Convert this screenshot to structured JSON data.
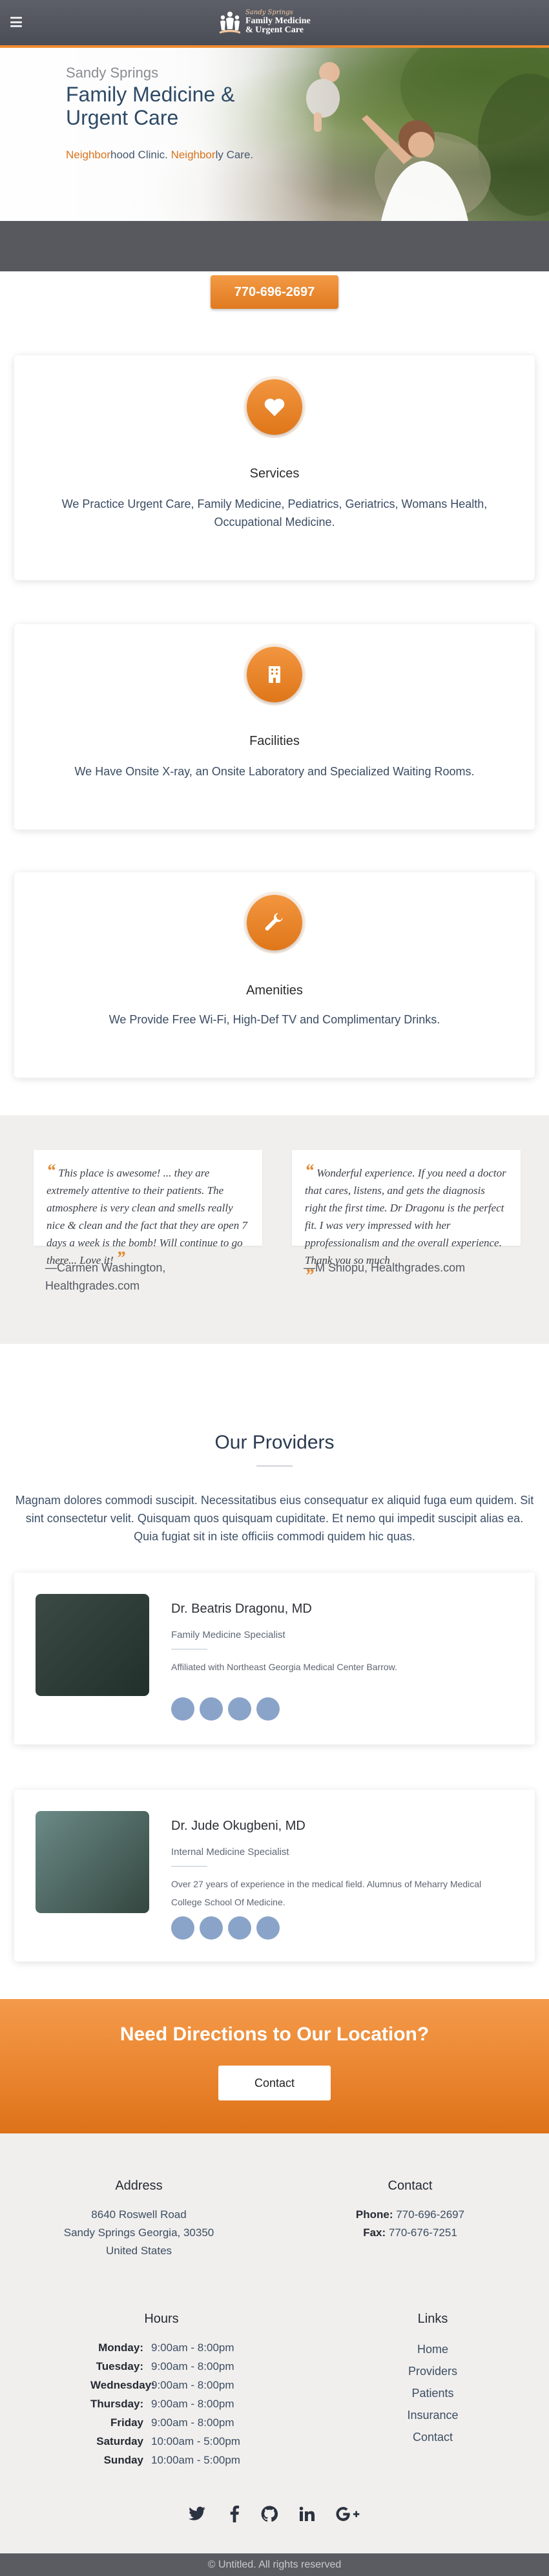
{
  "brand": {
    "logo_script": "Sandy Springs",
    "logo_line1": "Family Medicine",
    "logo_line2": "& Urgent Care"
  },
  "nav": {
    "menu_icon": "hamburger-menu-icon"
  },
  "hero": {
    "kicker": "Sandy Springs",
    "title": "Family Medicine & Urgent Care",
    "tag_accent_1": "Neighbor",
    "tag_plain_1": "hood Clinic. ",
    "tag_accent_2": "Neighbor",
    "tag_plain_2": "ly Care.",
    "phone": "770-696-2697"
  },
  "features": [
    {
      "icon": "heart-icon",
      "title": "Services",
      "text": "We Practice Urgent Care, Family Medicine, Pediatrics, Geriatrics, Womans Health, Occupational Medicine."
    },
    {
      "icon": "building-icon",
      "title": "Facilities",
      "text": "We Have Onsite X-ray, an Onsite Laboratory and Specialized Waiting Rooms."
    },
    {
      "icon": "wrench-icon",
      "title": "Amenities",
      "text": "We Provide Free Wi-Fi, High-Def TV and Complimentary Drinks."
    }
  ],
  "testimonials": [
    {
      "quote": "This place is awesome! ... they are extremely attentive to their patients. The atmosphere is very clean and smells really nice & clean and the fact that they are open 7 days a week is the bomb! Will continue to go there... Love it!",
      "author": "—Carmen Washington, Healthgrades.com"
    },
    {
      "quote": "Wonderful experience. If you need a doctor that cares, listens, and gets the diagnosis right the first time. Dr Dragonu is the perfect fit. I was very impressed with her pprofessionalism and the overall experience. Thank you so much",
      "author": "—M Shiopu, Healthgrades.com"
    }
  ],
  "providers": {
    "title": "Our Providers",
    "intro": "Magnam dolores commodi suscipit. Necessitatibus eius consequatur ex aliquid fuga eum quidem. Sit sint consectetur velit. Quisquam quos quisquam cupiditate. Et nemo qui impedit suscipit alias ea. Quia fugiat sit in iste officiis commodi quidem hic quas.",
    "items": [
      {
        "name": "Dr. Beatris Dragonu, MD",
        "role": "Family Medicine Specialist",
        "bio": "Affiliated with Northeast Georgia Medical Center Barrow."
      },
      {
        "name": "Dr. Jude Okugbeni, MD",
        "role": "Internal Medicine Specialist",
        "bio": "Over 27 years of experience in the medical field. Alumnus of Meharry Medical College School Of Medicine."
      }
    ]
  },
  "cta": {
    "title": "Need Directions to Our Location?",
    "button": "Contact"
  },
  "footer": {
    "address_heading": "Address",
    "address_lines": [
      "8640 Roswell Road",
      "Sandy Springs Georgia, 30350",
      "United States"
    ],
    "contact_heading": "Contact",
    "phone_label": "Phone:",
    "phone_value": " 770-696-2697",
    "fax_label": "Fax:",
    "fax_value": " 770-676-7251",
    "hours_heading": "Hours",
    "hours": [
      {
        "day": "Monday:",
        "time": "9:00am - 8:00pm"
      },
      {
        "day": "Tuesday:",
        "time": "9:00am - 8:00pm"
      },
      {
        "day": "Wednesday:",
        "time": "9:00am - 8:00pm"
      },
      {
        "day": "Thursday:",
        "time": "9:00am - 8:00pm"
      },
      {
        "day": "Friday",
        "time": "9:00am - 8:00pm"
      },
      {
        "day": "Saturday",
        "time": "10:00am - 5:00pm"
      },
      {
        "day": "Sunday",
        "time": "10:00am - 5:00pm"
      }
    ],
    "links_heading": "Links",
    "links": [
      "Home",
      "Providers",
      "Patients",
      "Insurance",
      "Contact"
    ],
    "social": [
      "twitter-icon",
      "facebook-icon",
      "github-icon",
      "linkedin-icon",
      "google-plus-icon"
    ],
    "copyright": "© Untitled. All rights reserved"
  },
  "colors": {
    "accent": "#ef8a2e",
    "navy": "#2e4a66",
    "nav_bg": "#4f525a"
  }
}
